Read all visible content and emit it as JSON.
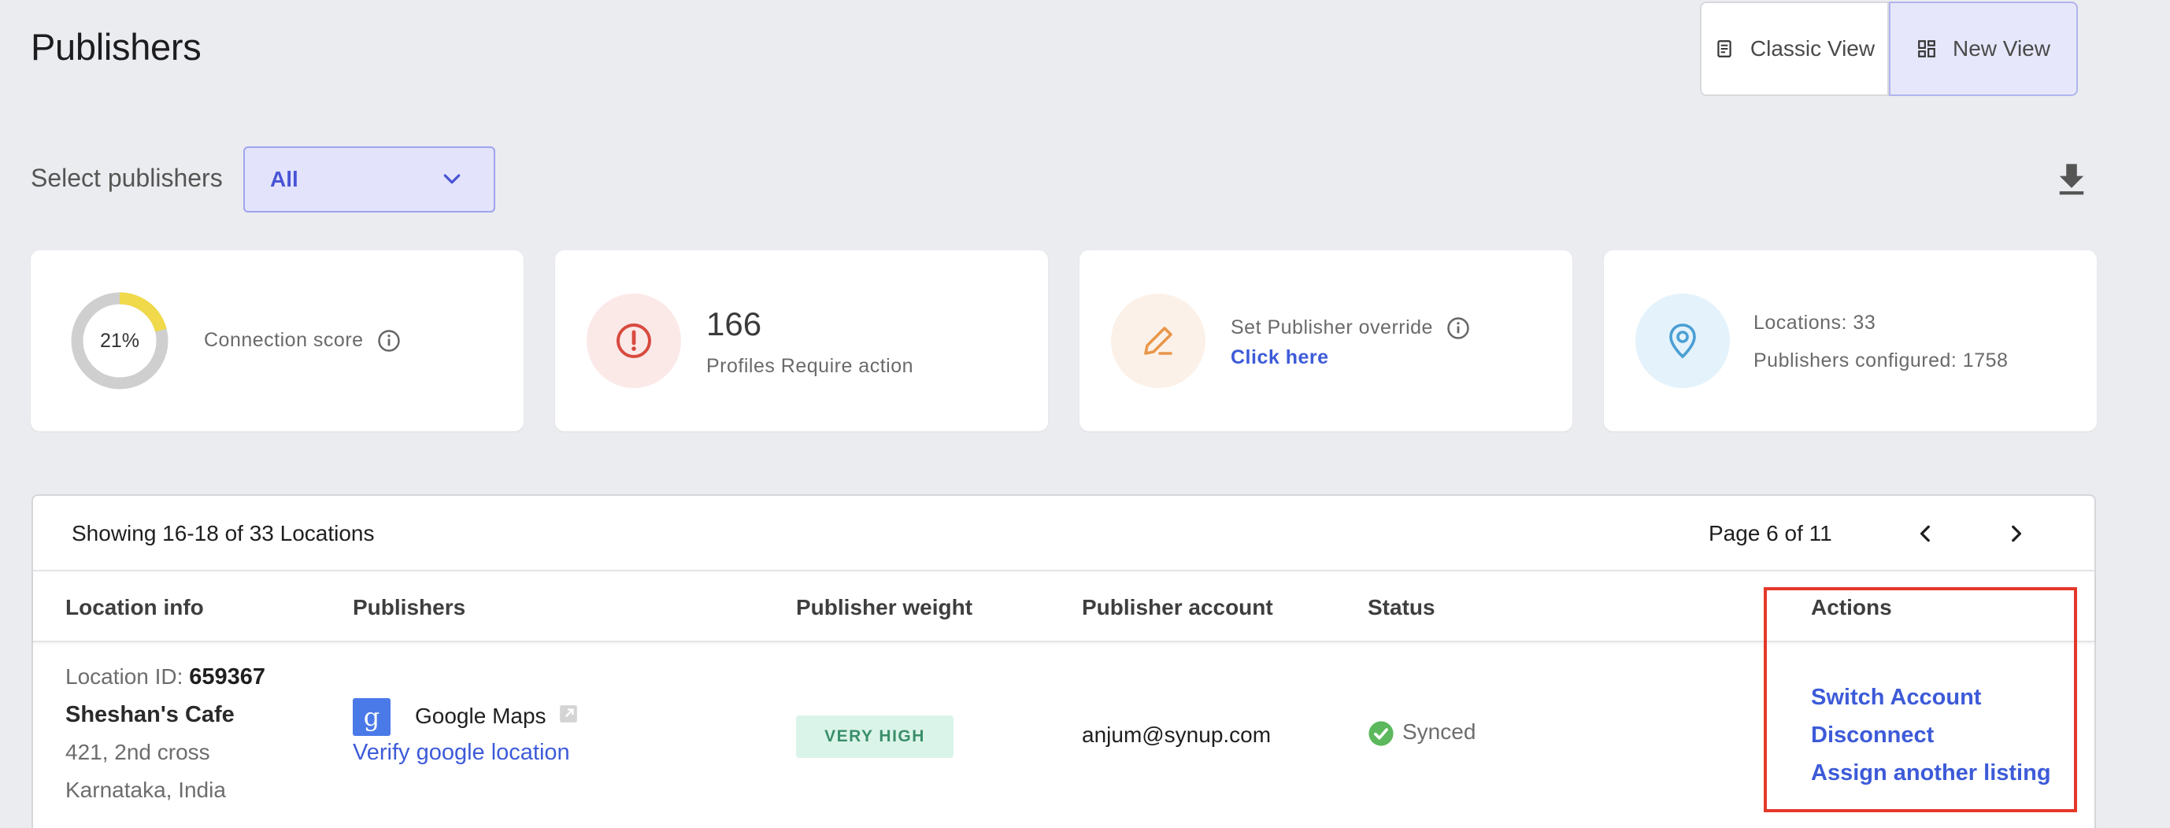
{
  "page": {
    "title": "Publishers"
  },
  "view_toggle": {
    "classic_label": "Classic View",
    "new_label": "New View",
    "active": "New View"
  },
  "filter": {
    "label": "Select publishers",
    "selected": "All"
  },
  "cards": {
    "connection": {
      "percent_label": "21%",
      "percent": 21,
      "label": "Connection score"
    },
    "profiles": {
      "count": "166",
      "label": "Profiles Require action"
    },
    "override": {
      "label": "Set Publisher override",
      "link": "Click here"
    },
    "summary": {
      "locations": "Locations: 33",
      "publishers": "Publishers configured: 1758"
    }
  },
  "table": {
    "showing": "Showing 16-18 of 33 Locations",
    "page_info": "Page 6 of 11",
    "columns": [
      "Location info",
      "Publishers",
      "Publisher weight",
      "Publisher account",
      "Status",
      "Actions"
    ],
    "rows": [
      {
        "location_id_label": "Location ID: ",
        "location_id": "659367",
        "name": "Sheshan's Cafe",
        "address1": "421, 2nd cross",
        "address2": "Karnataka, India",
        "publisher_icon_letter": "g",
        "publisher": "Google Maps",
        "publisher_link": "Verify google location",
        "weight": "VERY HIGH",
        "account": "anjum@synup.com",
        "status": "Synced",
        "actions": [
          "Switch Account",
          "Disconnect",
          "Assign another listing"
        ]
      }
    ]
  },
  "colors": {
    "accent": "#3d5bd8",
    "donut_fill": "#f0d94a",
    "alert_red": "#d84a3f",
    "edit_orange": "#e8964a",
    "location_blue": "#4a9fd4",
    "highlight": "#e3392b"
  }
}
